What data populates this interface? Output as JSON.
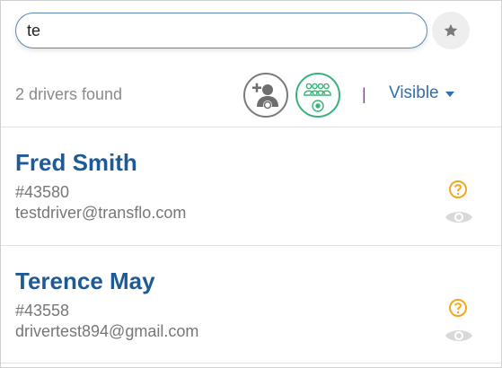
{
  "search": {
    "value": "te"
  },
  "status": {
    "count_text": "2 drivers found",
    "separator": "|",
    "visibility_filter": "Visible"
  },
  "drivers": [
    {
      "name": "Fred Smith",
      "id": "#43580",
      "email": "testdriver@transflo.com"
    },
    {
      "name": "Terence May",
      "id": "#43558",
      "email": "drivertest894@gmail.com"
    }
  ],
  "colors": {
    "accent_blue": "#1e5b96",
    "link_blue": "#2f6fad",
    "group_green": "#37b37a",
    "warning_orange": "#f2a81d"
  },
  "icons": [
    "star-icon",
    "add-driver-icon",
    "driver-group-icon",
    "help-circle-icon",
    "eye-icon",
    "chevron-down-icon"
  ]
}
